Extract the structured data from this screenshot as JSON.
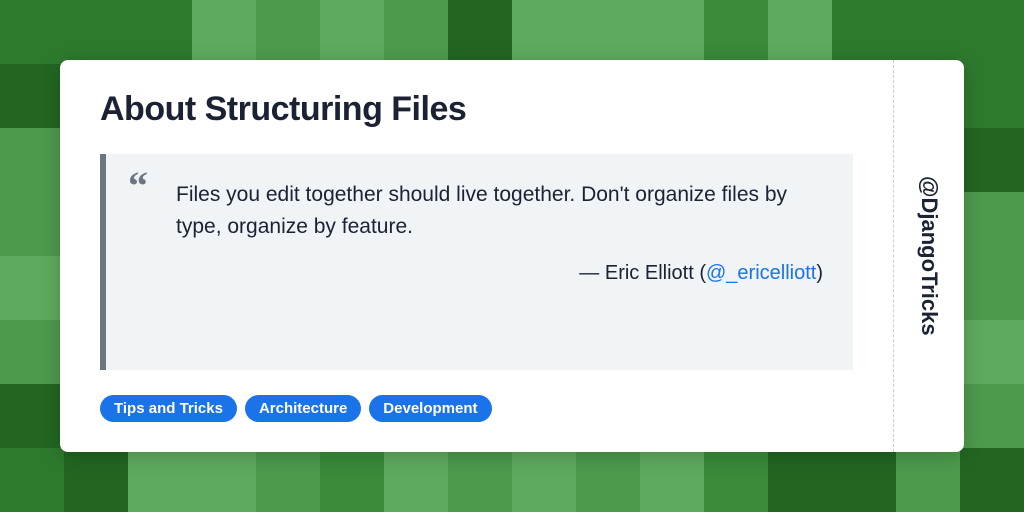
{
  "title": "About Structuring Files",
  "quote": {
    "text": "Files you edit together should live together. Don't organize files by type, organize by feature.",
    "author_prefix": "— Eric Elliott (",
    "author_handle": "@_ericelliott",
    "author_suffix": ")"
  },
  "tags": [
    "Tips and Tricks",
    "Architecture",
    "Development"
  ],
  "site_handle": "@DjangoTricks"
}
